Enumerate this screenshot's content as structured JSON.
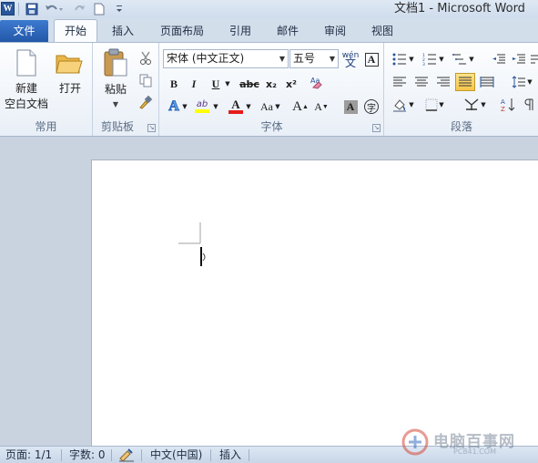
{
  "window": {
    "title": "文档1 - Microsoft Word",
    "logo_letter": "W"
  },
  "tabs": [
    "文件",
    "开始",
    "插入",
    "页面布局",
    "引用",
    "邮件",
    "审阅",
    "视图"
  ],
  "ribbon": {
    "common": {
      "label": "常用",
      "new_blank_line1": "新建",
      "new_blank_line2": "空白文档",
      "open": "打开"
    },
    "clipboard": {
      "label": "剪贴板",
      "paste": "粘贴"
    },
    "font": {
      "label": "字体",
      "font_name": "宋体 (中文正文)",
      "font_size": "五号",
      "bold": "B",
      "italic": "I",
      "underline": "U",
      "strikethrough": "abc",
      "subscript": "x₂",
      "superscript": "x²",
      "change_case": "Aa",
      "grow_font": "A",
      "shrink_font": "A",
      "wen": "wén",
      "highlight": "ab",
      "font_color_letter": "A",
      "highlight_color": "#ffff00",
      "font_color": "#e31c1c"
    },
    "paragraph": {
      "label": "段落"
    }
  },
  "status": {
    "page": "页面: 1/1",
    "words": "字数: 0",
    "language": "中文(中国)",
    "mode": "插入"
  },
  "watermark": {
    "brand": "电脑百事网",
    "url": "PC841.COM"
  }
}
